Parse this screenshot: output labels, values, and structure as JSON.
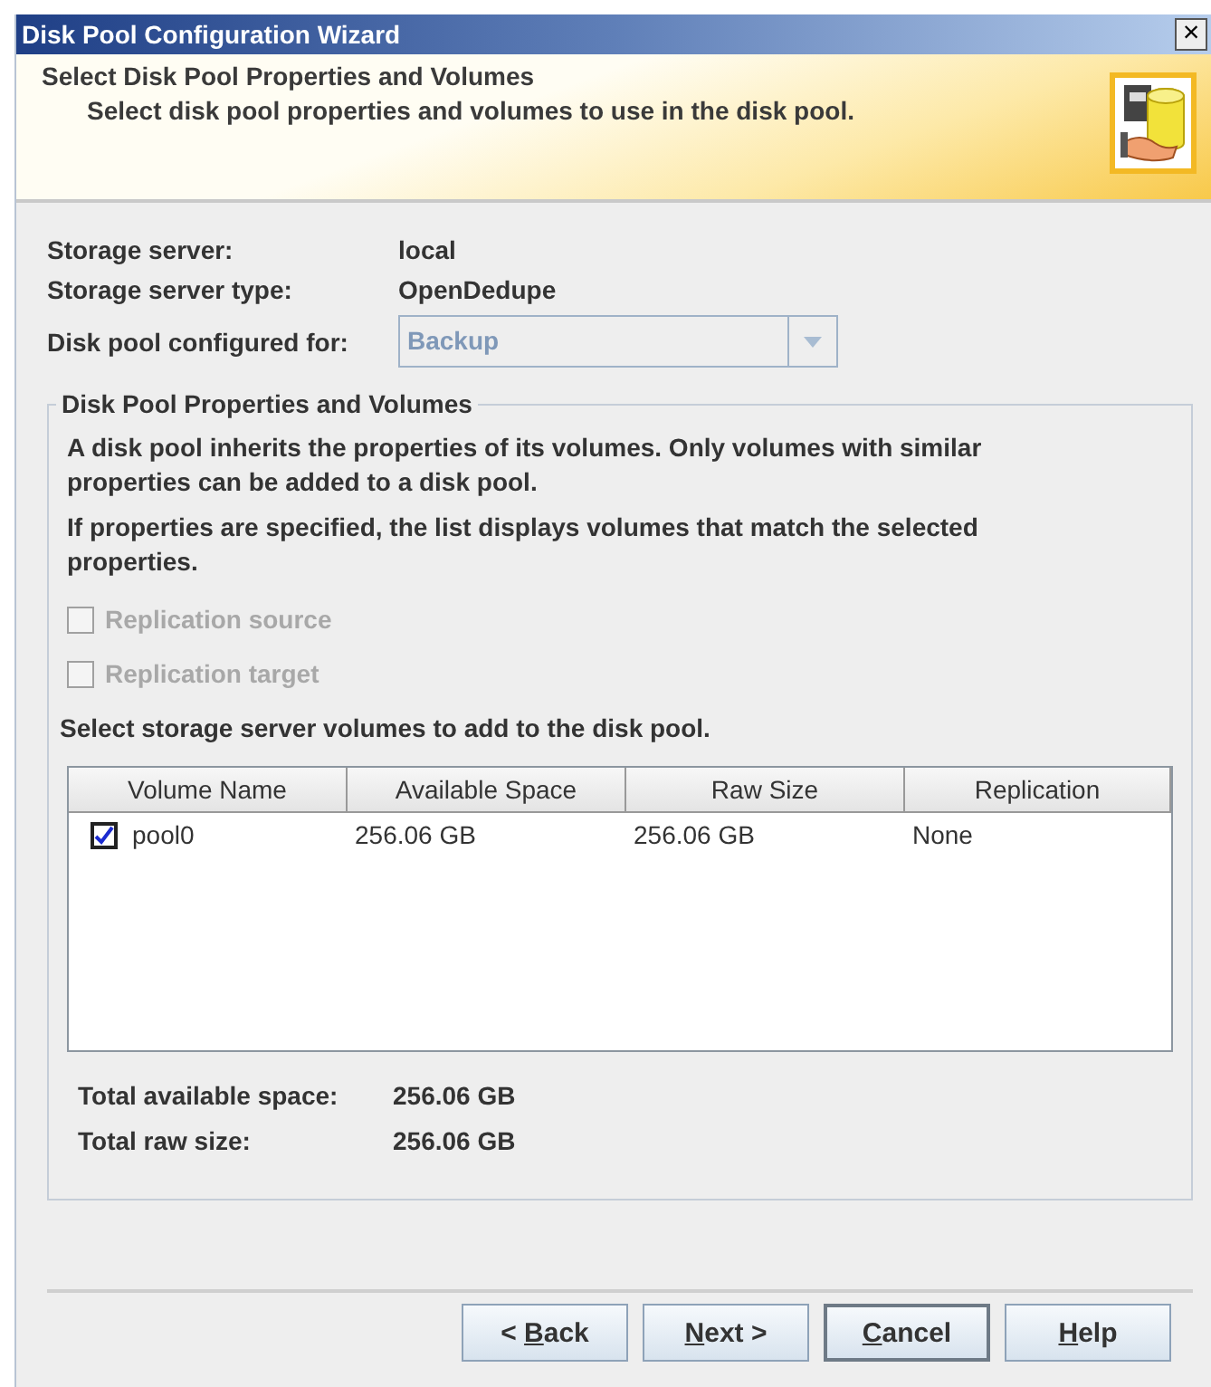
{
  "window": {
    "title": "Disk Pool Configuration Wizard",
    "close": "×"
  },
  "header": {
    "title": "Select Disk Pool Properties and Volumes",
    "subtitle": "Select disk pool properties and volumes to use in the disk pool."
  },
  "info": [
    {
      "label": "Storage server:",
      "value": "local"
    },
    {
      "label": "Storage server type:",
      "value": "OpenDedupe"
    }
  ],
  "pool_for": {
    "label": "Disk pool configured for:",
    "value": "Backup",
    "disabled": true
  },
  "group": {
    "title": "Disk Pool Properties and Volumes",
    "paragraphs": [
      "A disk pool inherits the properties of its volumes. Only volumes with similar properties can be added to a disk pool.",
      "If properties are specified, the list displays volumes that match the selected properties."
    ],
    "options": [
      {
        "label": "Replication source",
        "checked": false,
        "disabled": true
      },
      {
        "label": "Replication target",
        "checked": false,
        "disabled": true
      }
    ],
    "table_caption": "Select storage server volumes to add to the disk pool.",
    "table": {
      "columns": [
        "Volume Name",
        "Available Space",
        "Raw Size",
        "Replication"
      ],
      "rows": [
        {
          "checked": true,
          "cells": [
            "pool0",
            "256.06 GB",
            "256.06 GB",
            "None"
          ]
        }
      ]
    },
    "totals": [
      {
        "label": "Total available space:",
        "value": "256.06 GB"
      },
      {
        "label": "Total raw size:",
        "value": "256.06 GB"
      }
    ]
  },
  "buttons": [
    {
      "before": "< ",
      "mnemonic": "B",
      "after": "ack",
      "default": false
    },
    {
      "mnemonic": "N",
      "after": "ext >",
      "default": false
    },
    {
      "mnemonic": "C",
      "after": "ancel",
      "default": true
    },
    {
      "mnemonic": "H",
      "after": "elp",
      "default": false
    }
  ]
}
